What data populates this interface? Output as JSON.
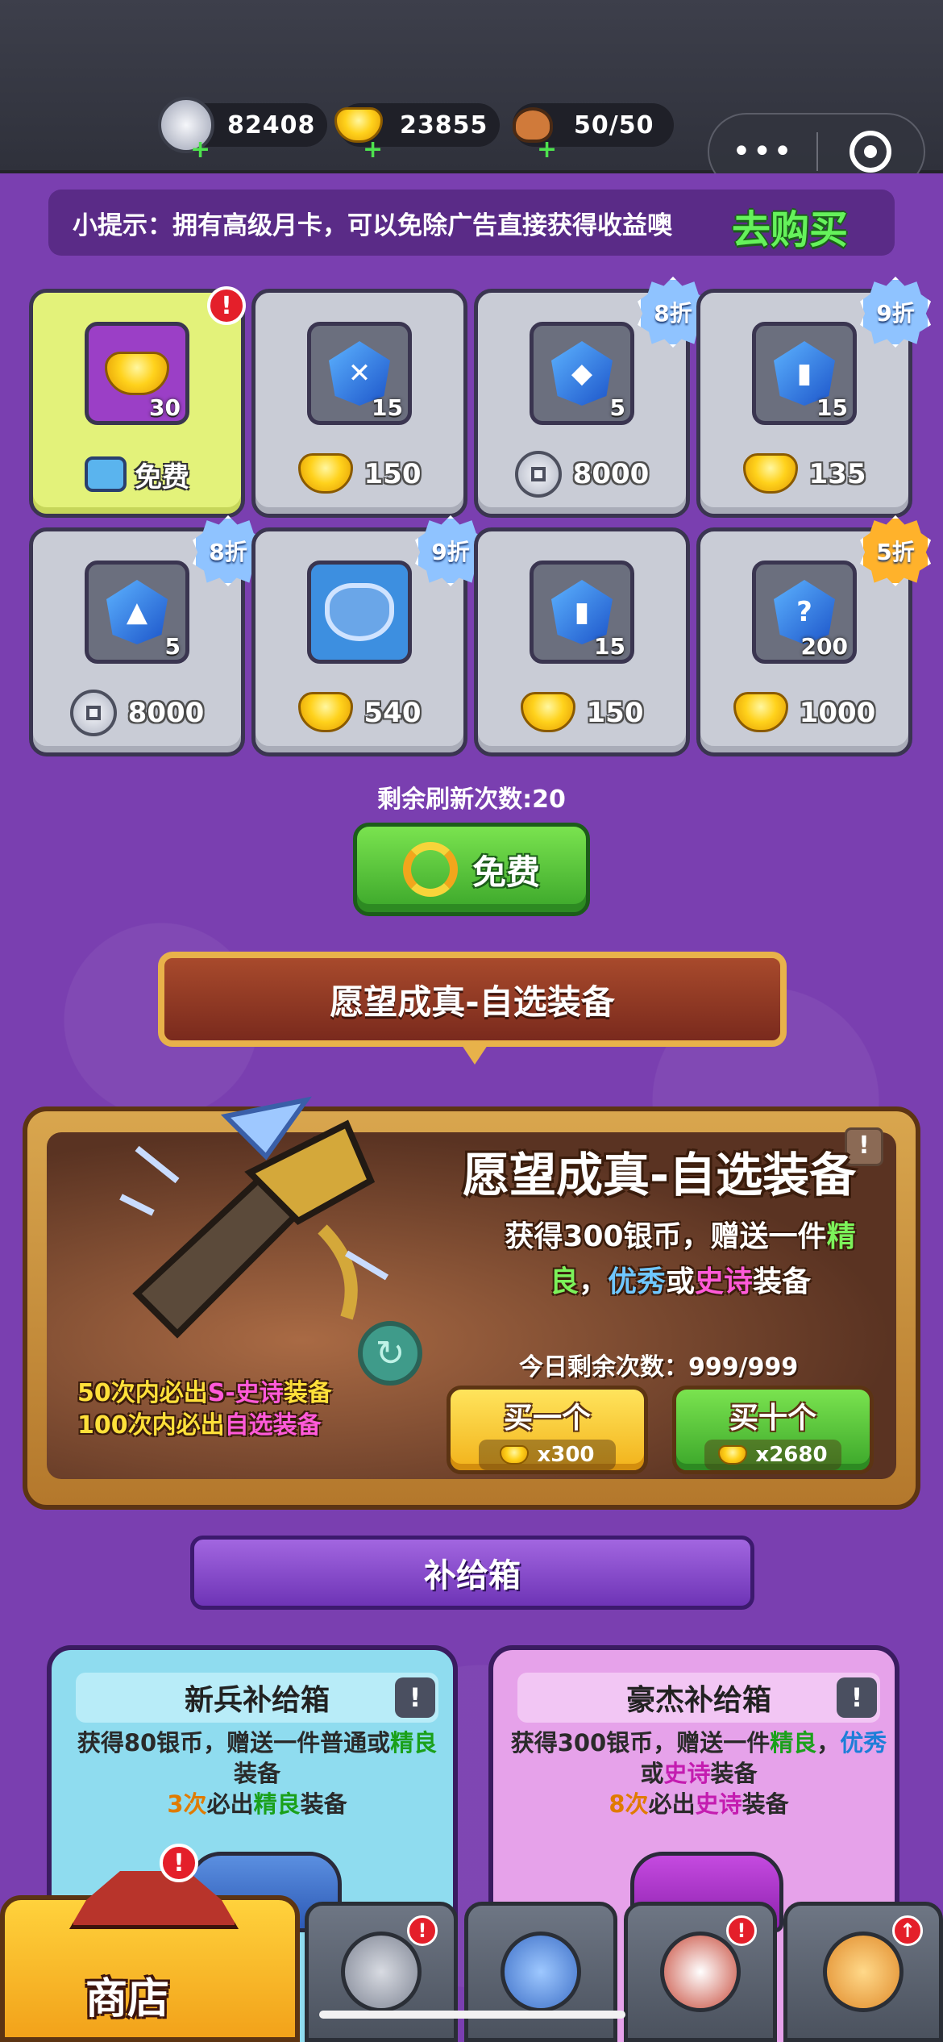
{
  "resources": [
    {
      "icon": "silver-coin-icon",
      "value": "82408"
    },
    {
      "icon": "gold-ingot-icon",
      "value": "23855"
    },
    {
      "icon": "meat-stamina-icon",
      "value": "50/50"
    }
  ],
  "capsule": {
    "more": "•••"
  },
  "tip": {
    "text": "小提示：拥有高级月卡，可以免除广告直接获得收益噢",
    "buy_label": "去购买"
  },
  "shop_items": [
    {
      "count": "30",
      "price": "免费",
      "currency": "ad",
      "discount": ""
    },
    {
      "count": "15",
      "price": "150",
      "currency": "gold",
      "discount": ""
    },
    {
      "count": "5",
      "price": "8000",
      "currency": "silver",
      "discount": "8折"
    },
    {
      "count": "15",
      "price": "135",
      "currency": "gold",
      "discount": "9折"
    },
    {
      "count": "5",
      "price": "8000",
      "currency": "silver",
      "discount": "8折"
    },
    {
      "count": "",
      "price": "540",
      "currency": "gold",
      "discount": "9折"
    },
    {
      "count": "15",
      "price": "150",
      "currency": "gold",
      "discount": ""
    },
    {
      "count": "200",
      "price": "1000",
      "currency": "gold",
      "discount": "5折"
    }
  ],
  "refresh": {
    "remaining": "剩余刷新次数:20",
    "button_label": "免费"
  },
  "wish_section": {
    "banner": "愿望成真-自选装备",
    "title": "愿望成真-自选装备",
    "desc_parts": [
      "获得300银币，赠送一件",
      "精良",
      "，",
      "优秀",
      "或",
      "史诗",
      "装备"
    ],
    "today": "今日剩余次数：999/999",
    "guarantee1": [
      "50次内必出",
      "S-史诗",
      "装备"
    ],
    "guarantee2": [
      "100次内必出",
      "自选装备"
    ],
    "buy_one": {
      "label": "买一个",
      "cost": "x300"
    },
    "buy_ten": {
      "label": "买十个",
      "cost": "x2680"
    },
    "info": "!"
  },
  "supply": {
    "title": "补给箱",
    "boxes": [
      {
        "name": "新兵补给箱",
        "desc": [
          "获得80银币，赠送一件普通或",
          "精良",
          "装备",
          "3次",
          "必出",
          "精良",
          "装备"
        ]
      },
      {
        "name": "豪杰补给箱",
        "desc": [
          "获得300银币，赠送一件",
          "精良",
          "，",
          "优秀",
          "或",
          "史诗",
          "装备",
          "8次",
          "必出",
          "史诗",
          "装备"
        ]
      }
    ]
  },
  "nav": {
    "shop_label": "商店"
  },
  "colors": {
    "accent_purple": "#7a3fb0",
    "buy_green": "#65f25b",
    "alert_red": "#e41f2a"
  }
}
